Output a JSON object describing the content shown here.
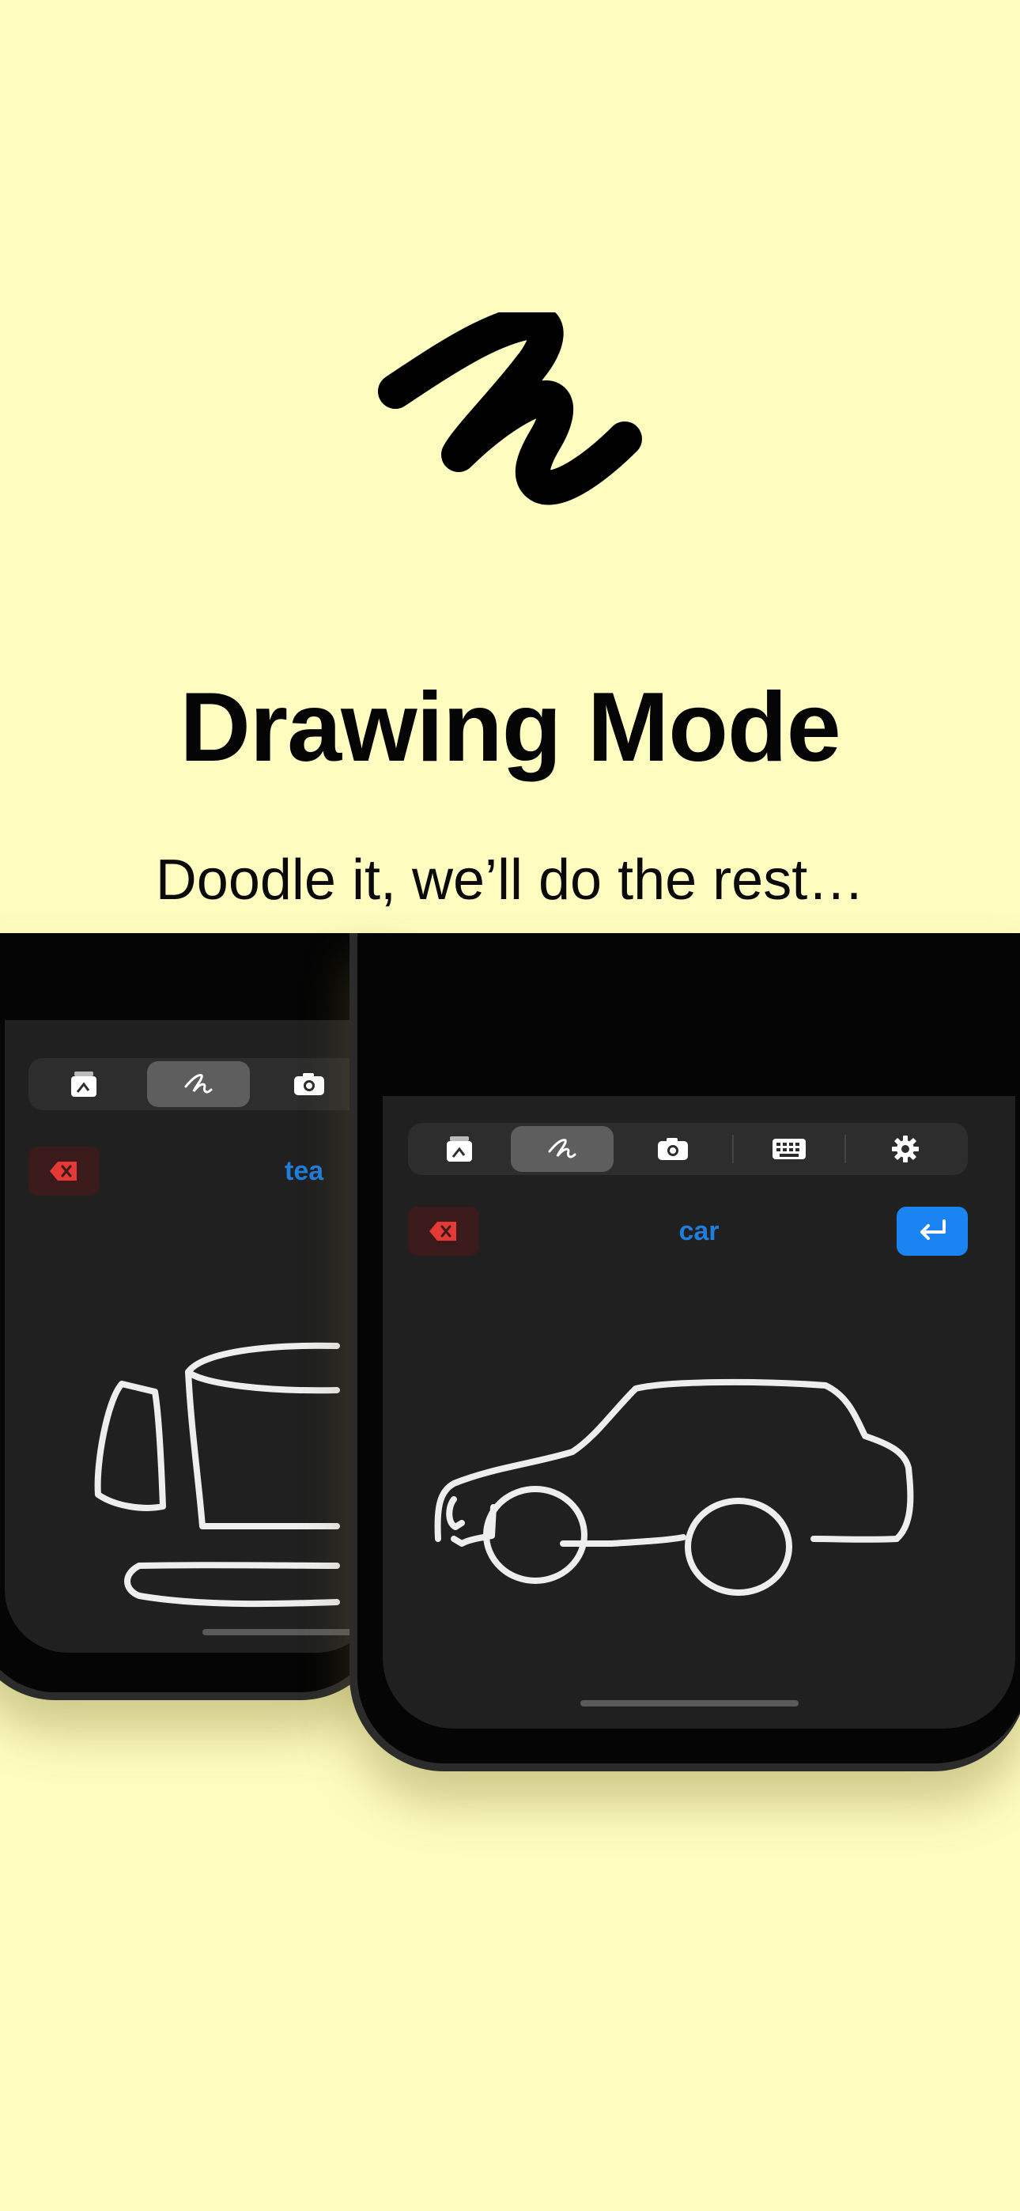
{
  "header": {
    "title": "Drawing Mode",
    "subtitle": "Doodle it, we’ll do the rest…"
  },
  "phones": [
    {
      "recognized_word": "tea",
      "tools": [
        "sticker-icon",
        "scribble-icon",
        "camera-icon"
      ],
      "active_tool": "scribble-icon"
    },
    {
      "recognized_word": "car",
      "tools": [
        "sticker-icon",
        "scribble-icon",
        "camera-icon",
        "keyboard-icon",
        "gear-icon"
      ],
      "active_tool": "scribble-icon"
    }
  ],
  "colors": {
    "background": "#fefcbf",
    "screen": "#202020",
    "accent_blue": "#1a84f2",
    "delete_red": "#e53935",
    "chalk": "#eeeeee"
  }
}
